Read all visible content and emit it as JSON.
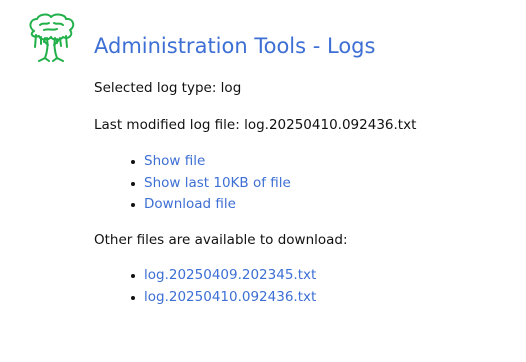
{
  "header": {
    "logo_icon": "tree-logo-icon",
    "logo_color": "#22b04a",
    "title": "Administration Tools - Logs",
    "title_color": "#3d6fd4"
  },
  "info": {
    "selected_log_type": "Selected log type: log",
    "last_modified": "Last modified log file: log.20250410.092436.txt"
  },
  "actions": [
    {
      "label": "Show file"
    },
    {
      "label": "Show last 10KB of file"
    },
    {
      "label": "Download file"
    }
  ],
  "other_files": {
    "heading": "Other files are available to download:",
    "files": [
      {
        "label": "log.20250409.202345.txt"
      },
      {
        "label": "log.20250410.092436.txt"
      }
    ]
  },
  "colors": {
    "link": "#3d6fd4",
    "text": "#111111"
  }
}
